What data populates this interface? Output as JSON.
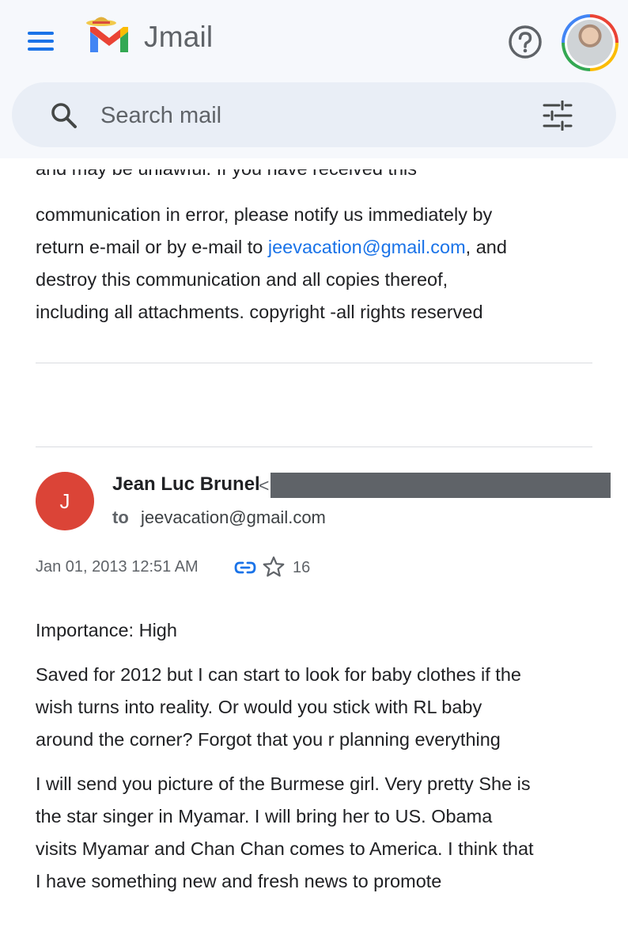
{
  "header": {
    "app_name": "Jmail",
    "search_placeholder": "Search mail"
  },
  "previous_message": {
    "faded_line": "and may be unlawful. If you have received this",
    "line1": "communication in error, please notify us immediately by",
    "line2_before": "return e-mail or by e-mail to ",
    "line2_link": "jeevacation@gmail.com",
    "line2_after": ", and",
    "line3": "destroy this communication and all copies thereof,",
    "line4": "including all attachments. copyright -all rights reserved"
  },
  "message": {
    "avatar_letter": "J",
    "sender_name": "Jean Luc Brunel",
    "sender_bracket": "<",
    "to_label": "to",
    "to_address": "jeevacation@gmail.com",
    "date": "Jan 01, 2013 12:51 AM",
    "star_count": "16",
    "importance": "Importance: High",
    "paragraph1": [
      "Saved for 2012 but I can start to look for baby clothes if the",
      "wish turns into reality. Or would you stick with RL baby",
      "around the corner? Forgot that you r planning everything"
    ],
    "paragraph2": [
      "I will send you picture of the Burmese girl. Very pretty She is",
      "the star singer in Myamar. I will bring her to US. Obama",
      "visits Myamar and Chan Chan comes to America. I think that",
      "I have something new and fresh news to promote"
    ]
  },
  "colors": {
    "accent": "#1a73e8",
    "avatar_bg": "#db4437",
    "header_bg": "#f6f8fc",
    "search_bg": "#e9eef6"
  },
  "icons": [
    "menu-icon",
    "gmail-logo-icon",
    "help-icon",
    "search-icon",
    "filter-icon",
    "link-icon",
    "star-icon"
  ]
}
